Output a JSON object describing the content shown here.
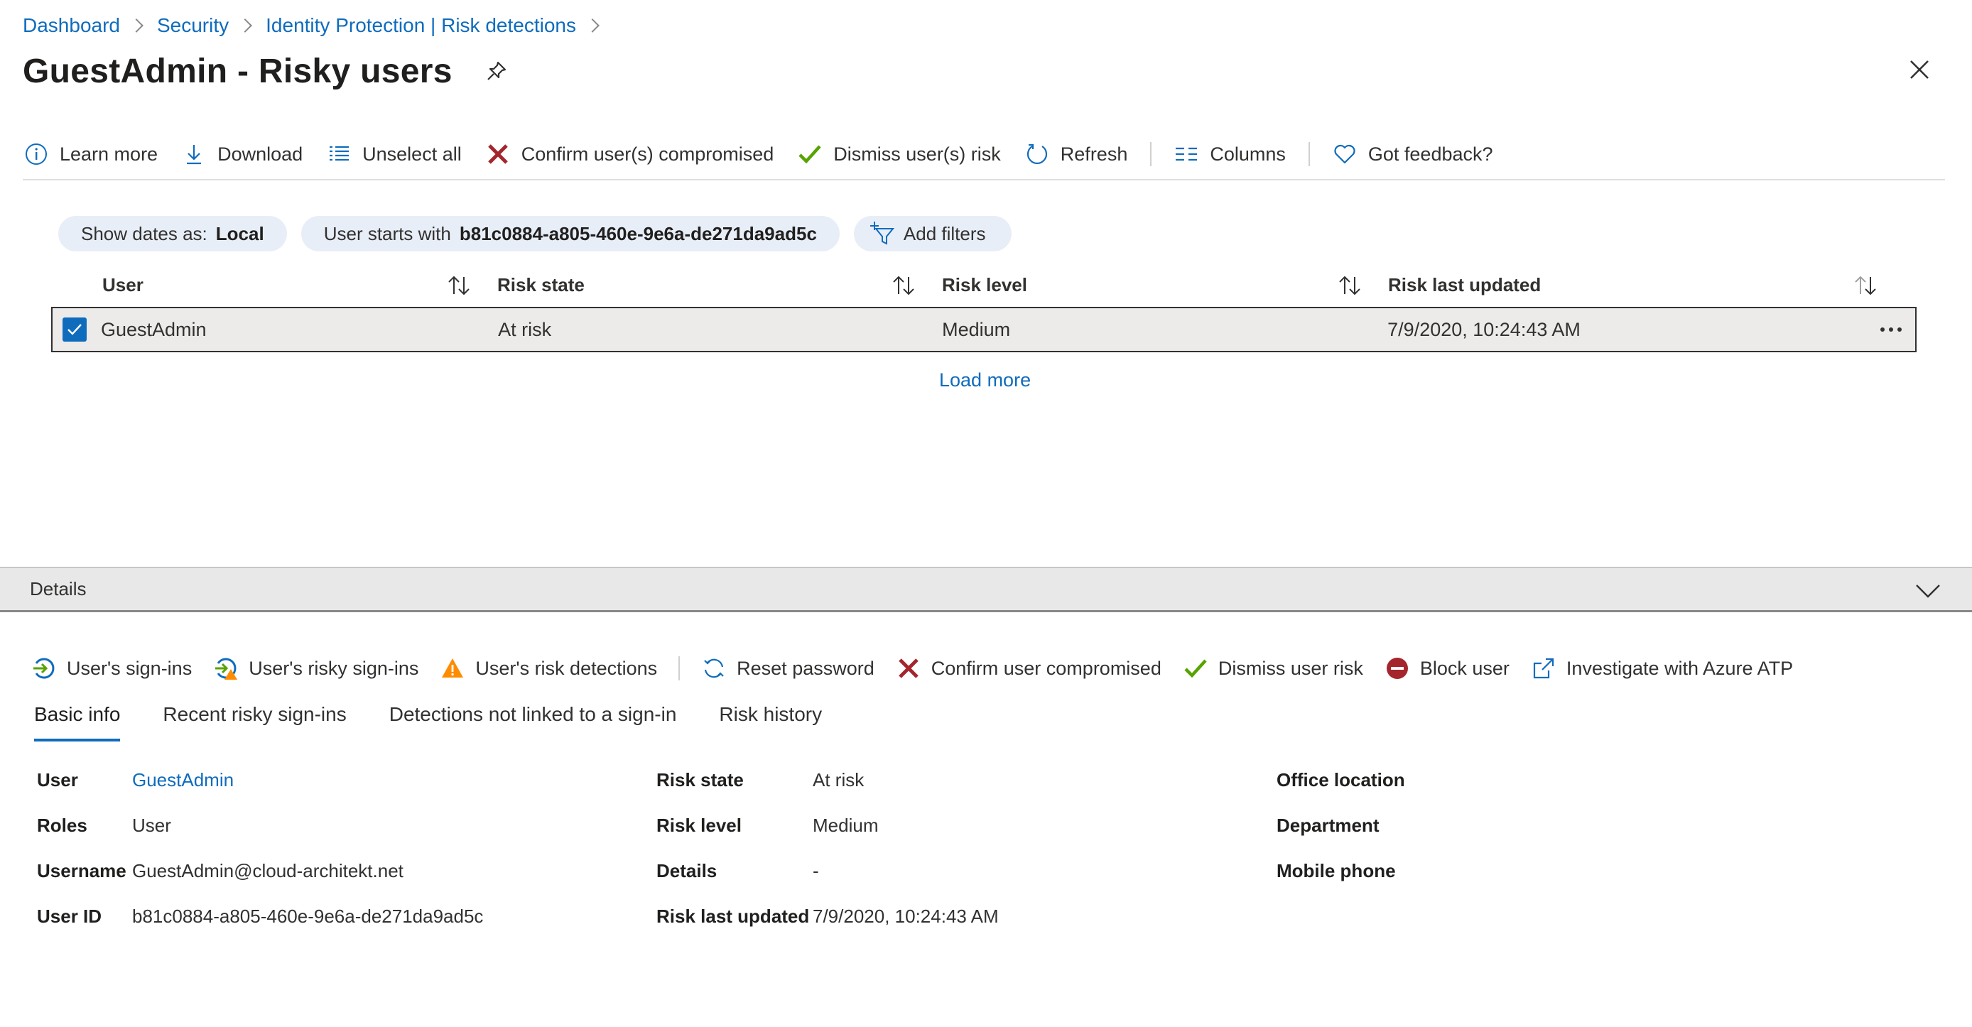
{
  "breadcrumb": [
    "Dashboard",
    "Security",
    "Identity Protection | Risk detections"
  ],
  "page_title": "GuestAdmin - Risky users",
  "toolbar": {
    "learn_more": "Learn more",
    "download": "Download",
    "unselect_all": "Unselect all",
    "confirm_compromised": "Confirm user(s) compromised",
    "dismiss_risk": "Dismiss user(s) risk",
    "refresh": "Refresh",
    "columns": "Columns",
    "feedback": "Got feedback?"
  },
  "filters": {
    "dates_label": "Show dates as:",
    "dates_value": "Local",
    "user_label": "User starts with",
    "user_value": "b81c0884-a805-460e-9e6a-de271da9ad5c",
    "add_filters": "Add filters"
  },
  "grid": {
    "columns": [
      "User",
      "Risk state",
      "Risk level",
      "Risk last updated"
    ],
    "rows": [
      {
        "user": "GuestAdmin",
        "risk_state": "At risk",
        "risk_level": "Medium",
        "risk_last_updated": "7/9/2020, 10:24:43 AM",
        "selected": true
      }
    ],
    "load_more": "Load more"
  },
  "details": {
    "title": "Details",
    "actions": {
      "sign_ins": "User's sign-ins",
      "risky_sign_ins": "User's risky sign-ins",
      "risk_detections": "User's risk detections",
      "reset_password": "Reset password",
      "confirm_compromised": "Confirm user compromised",
      "dismiss_risk": "Dismiss user risk",
      "block_user": "Block user",
      "investigate": "Investigate with Azure ATP"
    },
    "tabs": [
      "Basic info",
      "Recent risky sign-ins",
      "Detections not linked to a sign-in",
      "Risk history"
    ],
    "basic_info": {
      "user_label": "User",
      "user_value": "GuestAdmin",
      "roles_label": "Roles",
      "roles_value": "User",
      "username_label": "Username",
      "username_value": "GuestAdmin@cloud-architekt.net",
      "userid_label": "User ID",
      "userid_value": "b81c0884-a805-460e-9e6a-de271da9ad5c",
      "risk_state_label": "Risk state",
      "risk_state_value": "At risk",
      "risk_level_label": "Risk level",
      "risk_level_value": "Medium",
      "details_label": "Details",
      "details_value": "-",
      "risk_updated_label": "Risk last updated",
      "risk_updated_value": "7/9/2020, 10:24:43 AM",
      "office_label": "Office location",
      "department_label": "Department",
      "mobile_label": "Mobile phone"
    }
  },
  "colors": {
    "accent": "#0f6cbd",
    "danger": "#a4262c",
    "success": "#57a300",
    "warning": "#ff8c00"
  }
}
